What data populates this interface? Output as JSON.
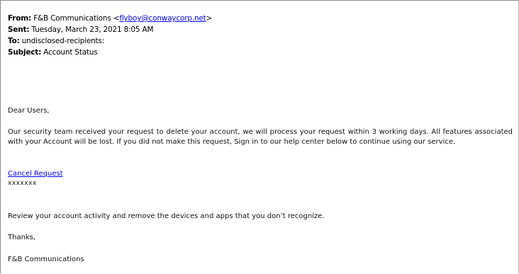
{
  "email": {
    "from_label": "From:",
    "from_name": "F&B Communications <",
    "from_email": "flyboy@conwaycorp.net",
    "from_close": ">",
    "sent_label": "Sent:",
    "sent_value": "Tuesday, March 23, 2021 8:05 AM",
    "to_label": "To:",
    "to_value": "undisclosed-recipients:",
    "subject_label": "Subject:",
    "subject_value": "Account Status"
  },
  "message": {
    "greeting": "Dear Users,",
    "paragraph1": "Our security team received your request to delete your account, we will process your request within 3 working days. All features associated with your Account will be lost. If you did not make this request,  Sign in  to our help center below  to continue using our service.",
    "cancel_link": "Cancel Request",
    "masked_text": "xxxxxxx",
    "review": "Review your account activity and remove the devices and apps that you don’t recognize.",
    "thanks": "Thanks,",
    "signature": "F&B Communications"
  }
}
